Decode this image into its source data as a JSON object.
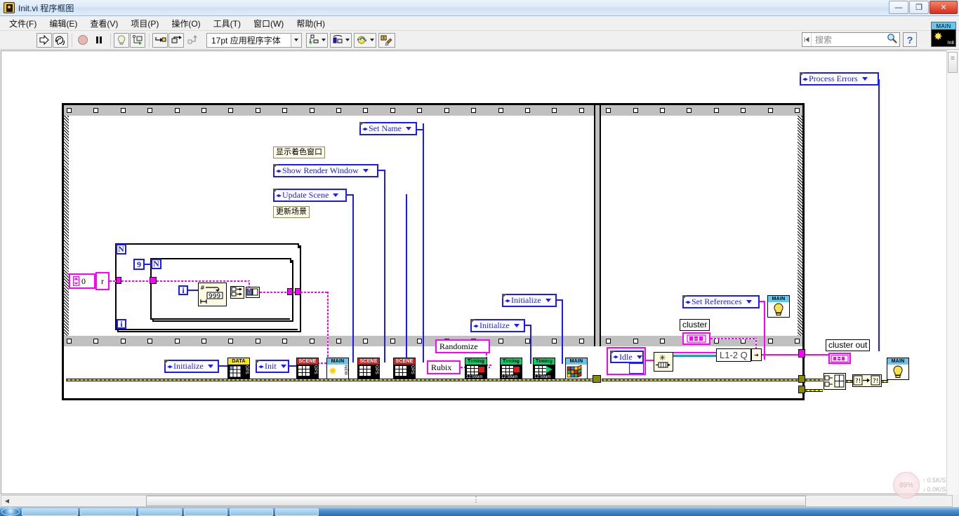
{
  "window": {
    "title": "Init.vi 程序框图",
    "icon": "labview-vi-icon",
    "buttons": {
      "minimize": "—",
      "maximize": "❐",
      "close": "✕"
    }
  },
  "menubar": {
    "items": [
      {
        "label": "文件(F)",
        "name": "menu-file"
      },
      {
        "label": "编辑(E)",
        "name": "menu-edit"
      },
      {
        "label": "查看(V)",
        "name": "menu-view"
      },
      {
        "label": "项目(P)",
        "name": "menu-project"
      },
      {
        "label": "操作(O)",
        "name": "menu-operate"
      },
      {
        "label": "工具(T)",
        "name": "menu-tools"
      },
      {
        "label": "窗口(W)",
        "name": "menu-window"
      },
      {
        "label": "帮助(H)",
        "name": "menu-help"
      }
    ]
  },
  "toolbar": {
    "run_tooltip": "运行",
    "run_continuous_tooltip": "连续运行",
    "abort_tooltip": "中止执行",
    "pause_tooltip": "暂停",
    "highlight_tooltip": "高亮显示执行过程",
    "retain_values_tooltip": "保存连线值",
    "step_into_tooltip": "单步步入",
    "step_over_tooltip": "单步步过",
    "step_out_tooltip": "单步步出",
    "font_label": "17pt 应用程序字体",
    "align_tooltip": "对齐对象",
    "distribute_tooltip": "分布对象",
    "resize_tooltip": "调整对象大小",
    "reorder_tooltip": "重新排序",
    "cleanup_tooltip": "整理程序框图"
  },
  "search": {
    "placeholder": "搜索",
    "icon": "search-icon",
    "help_icon": "help-question-icon"
  },
  "vi_icon": {
    "header": "MAIN",
    "label": "Init",
    "glyph": "star-icon"
  },
  "diagram": {
    "labels": {
      "show_render_window_cn": "显示着色窗口",
      "update_scene_cn": "更新场景",
      "cluster": "cluster",
      "cluster_out": "cluster out"
    },
    "enums": [
      {
        "name": "enum-process-errors",
        "label": "Process Errors"
      },
      {
        "name": "enum-set-name",
        "label": "Set Name"
      },
      {
        "name": "enum-show-render-window",
        "label": "Show Render Window"
      },
      {
        "name": "enum-update-scene",
        "label": "Update Scene"
      },
      {
        "name": "enum-initialize-data",
        "label": "Initialize"
      },
      {
        "name": "enum-init-scene",
        "label": "Init"
      },
      {
        "name": "enum-initialize-timing-a",
        "label": "Initialize"
      },
      {
        "name": "enum-initialize-timing-b",
        "label": "Initialize"
      },
      {
        "name": "enum-set-references",
        "label": "Set References"
      },
      {
        "name": "enum-idle",
        "label": "Idle"
      }
    ],
    "string_constants": [
      {
        "name": "string-constant-randomize",
        "value": "Randomize"
      },
      {
        "name": "string-constant-rubix",
        "value": "Rubix"
      }
    ],
    "numeric_constants": [
      {
        "name": "numeric-constant-zero",
        "value": "0"
      },
      {
        "name": "numeric-constant-nine",
        "value": "9"
      },
      {
        "name": "random-max-value",
        "value": "999"
      }
    ],
    "loop_terminals": {
      "outer_count": "N",
      "outer_index": "i",
      "inner_count": "N",
      "inner_index": "i"
    },
    "queue_node": {
      "name": "obtain-queue-node",
      "label": "L1-2 Q"
    },
    "subvis": [
      {
        "name": "subvi-data-ops",
        "header": "DATA",
        "header_color": "#ffe800",
        "side": "OPS",
        "glyph": "table-icon"
      },
      {
        "name": "subvi-scene-ops-1",
        "header": "SCENE",
        "header_color": "#e01b1b",
        "side": "OPS",
        "glyph": "cube-icon"
      },
      {
        "name": "subvi-main-new",
        "header": "MAIN",
        "header_color": "#62c8f0",
        "side": "NEW",
        "glyph": "star-icon"
      },
      {
        "name": "subvi-scene-ops-2",
        "header": "SCENE",
        "header_color": "#e01b1b",
        "side": "OPS",
        "glyph": "cube-icon"
      },
      {
        "name": "subvi-scene-ops-3",
        "header": "SCENE",
        "header_color": "#e01b1b",
        "side": "OPS",
        "glyph": "cube-icon"
      },
      {
        "name": "subvi-timing-1",
        "header": "Timing",
        "header_color": "#00d26a",
        "side": "",
        "glyph": "clock-stop-icon",
        "clock": "12:59am"
      },
      {
        "name": "subvi-timing-2",
        "header": "Timing",
        "header_color": "#00d26a",
        "side": "",
        "glyph": "clock-stop-icon",
        "clock": "12:59am"
      },
      {
        "name": "subvi-timing-3",
        "header": "Timing",
        "header_color": "#00d26a",
        "side": "",
        "glyph": "clock-play-icon",
        "clock": "12:59am"
      },
      {
        "name": "subvi-main-cube",
        "header": "MAIN",
        "header_color": "#62c8f0",
        "side": "",
        "glyph": "rubik-cube-icon"
      },
      {
        "name": "subvi-main-bulb-1",
        "header": "MAIN",
        "header_color": "#62c8f0",
        "side": "",
        "glyph": "lightbulb-icon"
      },
      {
        "name": "subvi-main-bulb-2",
        "header": "MAIN",
        "header_color": "#62c8f0",
        "side": "",
        "glyph": "lightbulb-icon"
      }
    ]
  },
  "scrollbars": {
    "h_left_arrow": "◀",
    "h_thumb_grip": "⋮",
    "v_thumb_grip": "≡"
  },
  "net_widget": {
    "percent": "89%",
    "upload": "0.5K/S",
    "download": "0.0K/S",
    "up_icon": "arrow-up-icon",
    "down_icon": "arrow-down-icon"
  },
  "colors": {
    "error_wire": "#8a8a00",
    "enum_border": "#1a1aff",
    "string_border": "#ff00ff",
    "refnum_wire": "#3fc9e0",
    "structure_border": "#000000",
    "structure_band": "#c0c0c0"
  }
}
